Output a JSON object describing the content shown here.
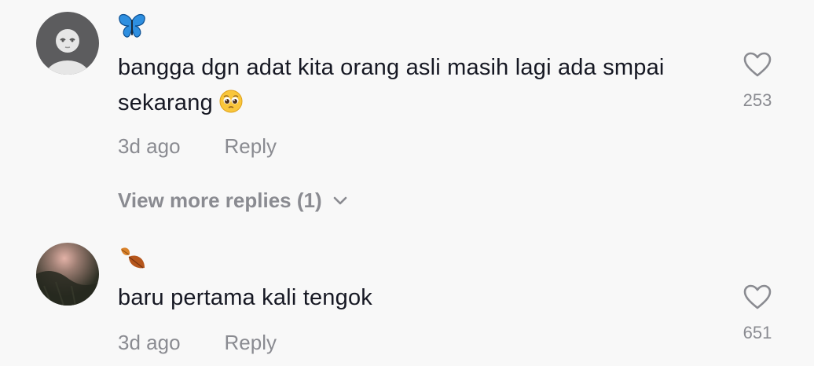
{
  "comments": [
    {
      "username_icon": "butterfly-emoji",
      "avatar_icon": "default-avatar-icon",
      "text": "bangga dgn adat kita orang asli masih lagi ada smpai sekarang",
      "emoji_icon": "pleading-face-emoji",
      "time": "3d ago",
      "reply_label": "Reply",
      "likes": "253"
    },
    {
      "username_icon": "fallen-leaf-emoji",
      "avatar_icon": "photo-avatar",
      "text": "baru pertama kali tengok",
      "time": "3d ago",
      "reply_label": "Reply",
      "likes": "651"
    }
  ],
  "view_more": {
    "label": "View more replies (1)"
  },
  "colors": {
    "background": "#f8f8f8",
    "text": "#161823",
    "muted": "#8a8b91"
  }
}
